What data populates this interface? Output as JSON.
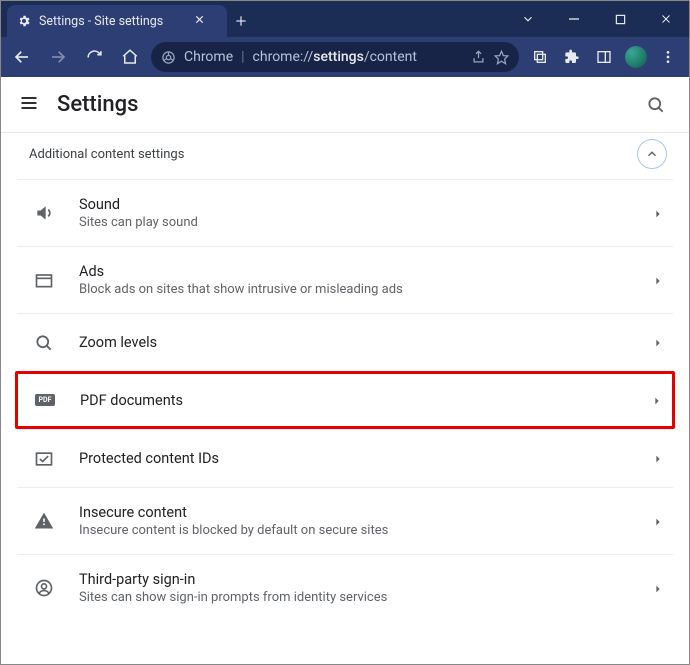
{
  "window": {
    "tab_title": "Settings - Site settings"
  },
  "address": {
    "prefix": "Chrome",
    "url_plain_before": "chrome://",
    "url_bold": "settings",
    "url_plain_after": "/content"
  },
  "appbar": {
    "title": "Settings"
  },
  "section": {
    "header": "Additional content settings"
  },
  "rows": [
    {
      "title": "Sound",
      "subtitle": "Sites can play sound"
    },
    {
      "title": "Ads",
      "subtitle": "Block ads on sites that show intrusive or misleading ads"
    },
    {
      "title": "Zoom levels",
      "subtitle": ""
    },
    {
      "title": "PDF documents",
      "subtitle": ""
    },
    {
      "title": "Protected content IDs",
      "subtitle": ""
    },
    {
      "title": "Insecure content",
      "subtitle": "Insecure content is blocked by default on secure sites"
    },
    {
      "title": "Third-party sign-in",
      "subtitle": "Sites can show sign-in prompts from identity services"
    }
  ]
}
